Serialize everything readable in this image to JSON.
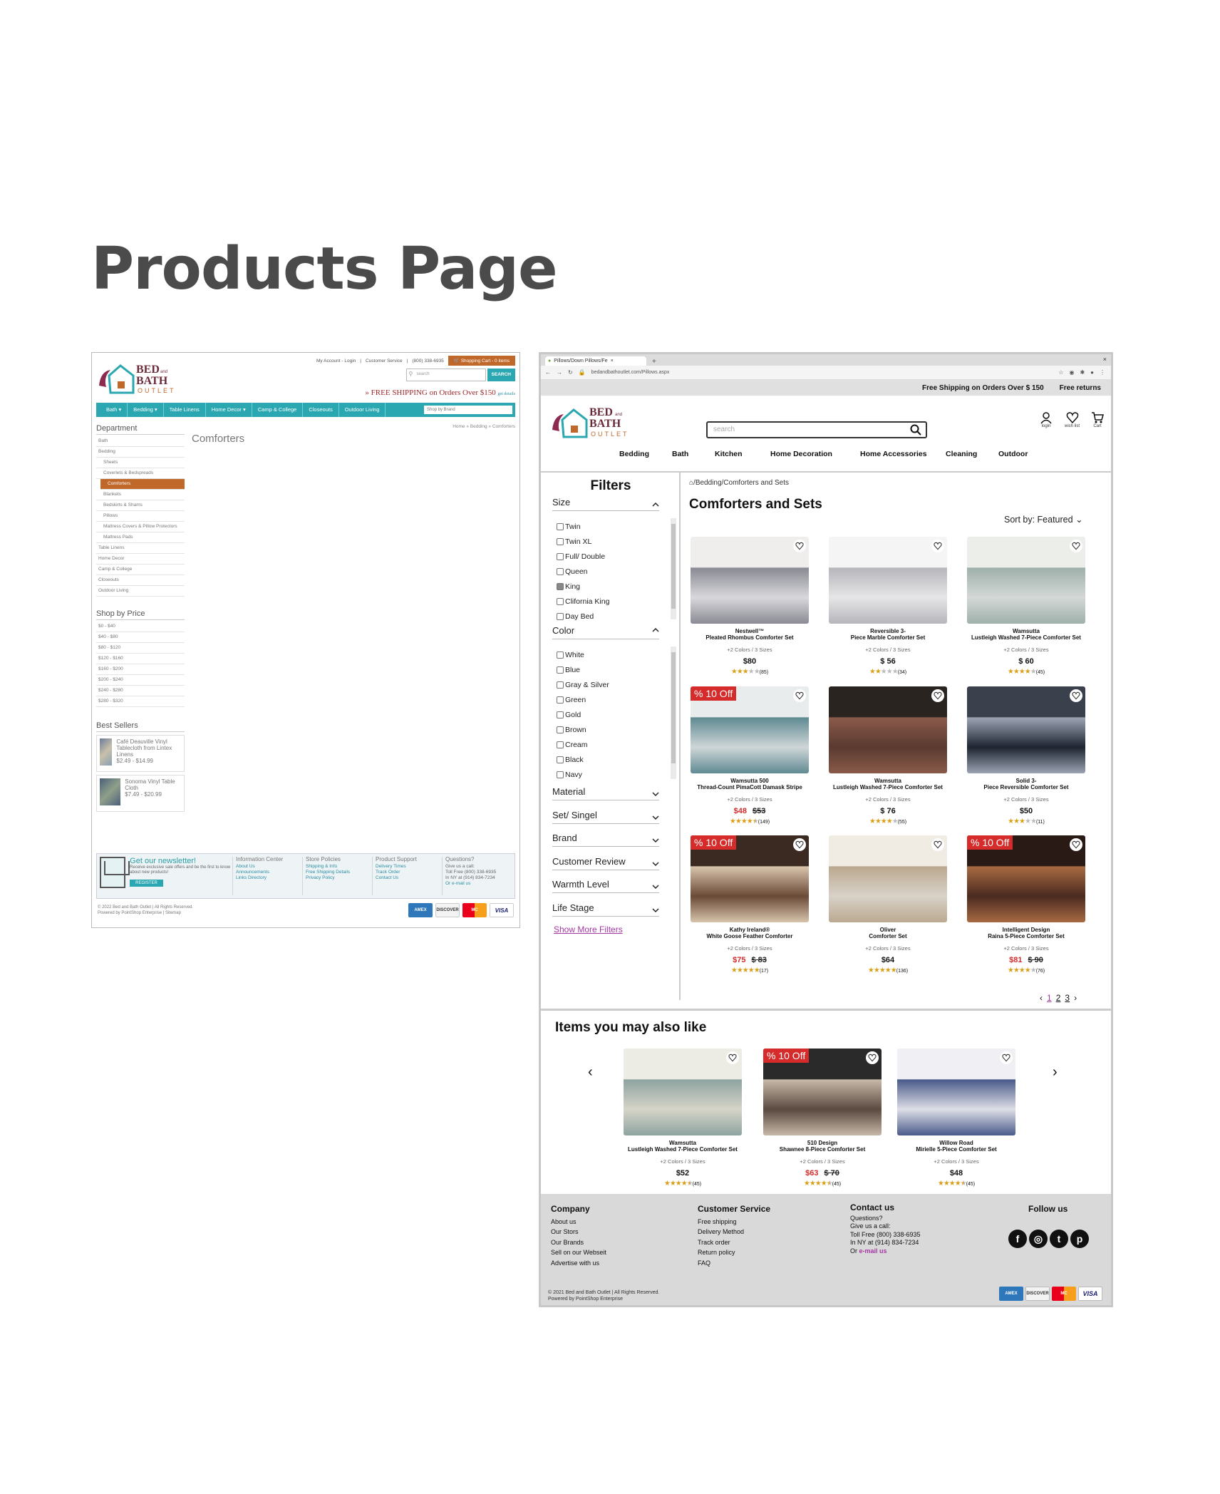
{
  "page_title": "Products Page",
  "old_site": {
    "top_links": [
      "My Account - Login",
      "|",
      "Customer Service",
      "|",
      "(800) 338-6935"
    ],
    "cart": "Shopping Cart - 0 items",
    "search_placeholder": "search",
    "search_button": "SEARCH",
    "shipping": "» FREE SHIPPING on Orders Over $150",
    "shipping_details": "get details",
    "nav": [
      "Bath ▾",
      "Bedding ▾",
      "Table Linens",
      "Home Decor ▾",
      "Camp & College",
      "Closeouts",
      "Outdoor Living"
    ],
    "brand_select": "Shop by Brand",
    "breadcrumb": "Home » Bedding » Comforters",
    "heading": "Comforters",
    "department_title": "Department",
    "departments": [
      {
        "label": "Bath",
        "sub": false,
        "active": false
      },
      {
        "label": "Bedding",
        "sub": false,
        "active": false
      },
      {
        "label": "Sheets",
        "sub": true,
        "active": false
      },
      {
        "label": "Coverlets & Bedspreads",
        "sub": true,
        "active": false
      },
      {
        "label": "Comforters",
        "sub": true,
        "active": true
      },
      {
        "label": "Blankets",
        "sub": true,
        "active": false
      },
      {
        "label": "Bedskirts & Shams",
        "sub": true,
        "active": false
      },
      {
        "label": "Pillows",
        "sub": true,
        "active": false
      },
      {
        "label": "Mattress Covers & Pillow Protectors",
        "sub": true,
        "active": false
      },
      {
        "label": "Mattress Pads",
        "sub": true,
        "active": false
      },
      {
        "label": "Table Linens",
        "sub": false,
        "active": false
      },
      {
        "label": "Home Decor",
        "sub": false,
        "active": false
      },
      {
        "label": "Camp & College",
        "sub": false,
        "active": false
      },
      {
        "label": "Closeouts",
        "sub": false,
        "active": false
      },
      {
        "label": "Outdoor Living",
        "sub": false,
        "active": false
      }
    ],
    "price_title": "Shop by Price",
    "prices": [
      "$0 - $40",
      "$40 - $80",
      "$80 - $120",
      "$120 - $160",
      "$160 - $200",
      "$200 - $240",
      "$240 - $280",
      "$280 - $320"
    ],
    "best_title": "Best Sellers",
    "best": [
      {
        "name": "Café Deauville Vinyl Tablecloth from Lintex Linens",
        "price": "$2.49 - $14.99"
      },
      {
        "name": "Sonoma Vinyl Table Cloth",
        "price": "$7.49 - $20.99"
      }
    ],
    "newsletter_title": "Get our newsletter!",
    "newsletter_desc": "Receive exclusive sale offers and be the first to know about new products!",
    "register": "REGISTER",
    "footer_cols": [
      {
        "title": "Information Center",
        "links": [
          "About Us",
          "Announcements",
          "Links Directory"
        ]
      },
      {
        "title": "Store Policies",
        "links": [
          "Shipping & Info",
          "Free Shipping Details",
          "Privacy Policy"
        ]
      },
      {
        "title": "Product Support",
        "links": [
          "Delivery Times",
          "Track Order",
          "Contact Us"
        ]
      }
    ],
    "questions_title": "Questions?",
    "questions": [
      "Give us a call:",
      "Toll Free (800) 338-6935",
      "In NY at (914) 834-7234",
      "Or e-mail us"
    ],
    "copyright": [
      "© 2022 Bed and Bath Outlet | All Rights Reserved.",
      "Powered by PointShop Enterprise | Sitemap"
    ],
    "cards": [
      "AMEX",
      "DISCOVER",
      "MC",
      "VISA"
    ]
  },
  "new_site": {
    "tab_title": "Pillows/Down Pillows/Fe",
    "url": "bedandbathoutlet.com/Pillows.aspx",
    "ship_bar": [
      "Free Shipping on Orders Over $ 150",
      "Free returns"
    ],
    "search_placeholder": "search",
    "user_links": [
      "login",
      "wish list",
      "Cart"
    ],
    "nav": [
      "Bedding",
      "Bath",
      "Kitchen",
      "Home Decoration",
      "Home Accessories",
      "Cleaning",
      "Outdoor"
    ],
    "filters_title": "Filters",
    "size_title": "Size",
    "sizes": [
      {
        "label": "Twin",
        "on": false
      },
      {
        "label": "Twin XL",
        "on": false
      },
      {
        "label": "Full/ Double",
        "on": false
      },
      {
        "label": "Queen",
        "on": false
      },
      {
        "label": "King",
        "on": true
      },
      {
        "label": "Clifornia King",
        "on": false
      },
      {
        "label": "Day Bed",
        "on": false
      }
    ],
    "color_title": "Color",
    "colors": [
      "White",
      "Blue",
      "Gray & Silver",
      "Green",
      "Gold",
      "Brown",
      "Cream",
      "Black",
      "Navy"
    ],
    "more_filters": [
      "Material",
      "Set/ Singel",
      "Brand",
      "Customer Review",
      "Warmth Level",
      "Life Stage"
    ],
    "show_more": "Show More Filters",
    "breadcrumb": "/Bedding/Comforters and Sets",
    "title": "Comforters and Sets",
    "sort": "Sort by: Featured",
    "products": [
      {
        "brand": "Nestwell™",
        "name": "Pleated Rhombus Comforter Set",
        "variants": "+2 Colors / 3 Sizes",
        "price": "$80",
        "sale": "",
        "old": "",
        "stars": "★★★★★",
        "rating": 3,
        "count": "(85)",
        "badge": ""
      },
      {
        "brand": "Reversible 3-",
        "name": "Piece Marble Comforter Set",
        "variants": "+2 Colors / 3 Sizes",
        "price": "$ 56",
        "sale": "",
        "old": "",
        "stars": "★★★★★",
        "rating": 2,
        "count": "(34)",
        "badge": ""
      },
      {
        "brand": "Wamsutta",
        "name": "Lustleigh Washed 7-Piece Comforter Set",
        "variants": "+2 Colors / 3 Sizes",
        "price": "$ 60",
        "sale": "",
        "old": "",
        "stars": "★★★★★",
        "rating": 4,
        "count": "(45)",
        "badge": ""
      },
      {
        "brand": "Wamsutta 500",
        "name": "Thread-Count PimaCott Damask Stripe",
        "variants": "+2 Colors / 3 Sizes",
        "price": "",
        "sale": "$48",
        "old": "$53",
        "stars": "★★★★★",
        "rating": 4.5,
        "count": "(149)",
        "badge": "% 10 Off"
      },
      {
        "brand": "Wamsutta",
        "name": "Lustleigh Washed 7-Piece Comforter Set",
        "variants": "+2 Colors / 3 Sizes",
        "price": "$ 76",
        "sale": "",
        "old": "",
        "stars": "★★★★★",
        "rating": 4,
        "count": "(55)",
        "badge": ""
      },
      {
        "brand": "Solid 3-",
        "name": "Piece Reversible Comforter Set",
        "variants": "+2 Colors / 3 Sizes",
        "price": "$50",
        "sale": "",
        "old": "",
        "stars": "★★★★★",
        "rating": 3,
        "count": "(11)",
        "badge": ""
      },
      {
        "brand": "Kathy Ireland®",
        "name": "White Goose Feather Comforter",
        "variants": "+2 Colors / 3 Sizes",
        "price": "",
        "sale": "$75",
        "old": "$ 83",
        "stars": "★★★★★",
        "rating": 5,
        "count": "(17)",
        "badge": "% 10 Off"
      },
      {
        "brand": "Oliver",
        "name": "Comforter Set",
        "variants": "+2 Colors / 3 Sizes",
        "price": "$64",
        "sale": "",
        "old": "",
        "stars": "★★★★★",
        "rating": 5,
        "count": "(136)",
        "badge": ""
      },
      {
        "brand": "Intelligent Design",
        "name": "Raina 5-Piece Comforter Set",
        "variants": "+2 Colors / 3 Sizes",
        "price": "",
        "sale": "$81",
        "old": "$ 90",
        "stars": "★★★★★",
        "rating": 4,
        "count": "(76)",
        "badge": "% 10 Off"
      }
    ],
    "pages": [
      "‹",
      "1",
      "2",
      "3",
      "›"
    ],
    "related_title": "Items you may  also like",
    "related": [
      {
        "brand": "Wamsutta",
        "name": "Lustleigh Washed 7-Piece Comforter Set",
        "variants": "+2 Colors / 3 Sizes",
        "price": "$52",
        "sale": "",
        "old": "",
        "stars": "★★★★★",
        "rating": 4.5,
        "count": "(45)",
        "badge": ""
      },
      {
        "brand": "510 Design",
        "name": "Shawnee 8-Piece Comforter Set",
        "variants": "+2 Colors / 3 Sizes",
        "price": "",
        "sale": "$63",
        "old": "$ 70",
        "stars": "★★★★★",
        "rating": 4.5,
        "count": "(45)",
        "badge": "% 10 Off"
      },
      {
        "brand": "Willow Road",
        "name": "Mirielle 5-Piece Comforter Set",
        "variants": "+2 Colors / 3 Sizes",
        "price": "$48",
        "sale": "",
        "old": "",
        "stars": "★★★★★",
        "rating": 4.5,
        "count": "(45)",
        "badge": ""
      }
    ],
    "footer": {
      "company_title": "Company",
      "company": [
        "About us",
        "Our Stors",
        "Our Brands",
        "Sell on our Webseit",
        "Advertise with us"
      ],
      "service_title": "Customer Service",
      "service": [
        "Free shipping",
        "Delivery Method",
        "Track order",
        "Return policy",
        "FAQ"
      ],
      "contact_title": "Contact us",
      "contact": [
        "Questions?",
        "Give us a call:",
        "Toll Free (800) 338-6935",
        "In NY at (914) 834-7234"
      ],
      "email_prefix": "Or ",
      "email": "e-mail us",
      "follow_title": "Follow us",
      "social": [
        "f",
        "◎",
        "t",
        "p"
      ],
      "copyright": [
        "© 2021 Bed and Bath Outlet | All Rights Reserved.",
        "Powered by PointShop Enterprise"
      ],
      "cards": [
        "AMEX",
        "DISCOVER",
        "MC",
        "VISA"
      ]
    }
  }
}
